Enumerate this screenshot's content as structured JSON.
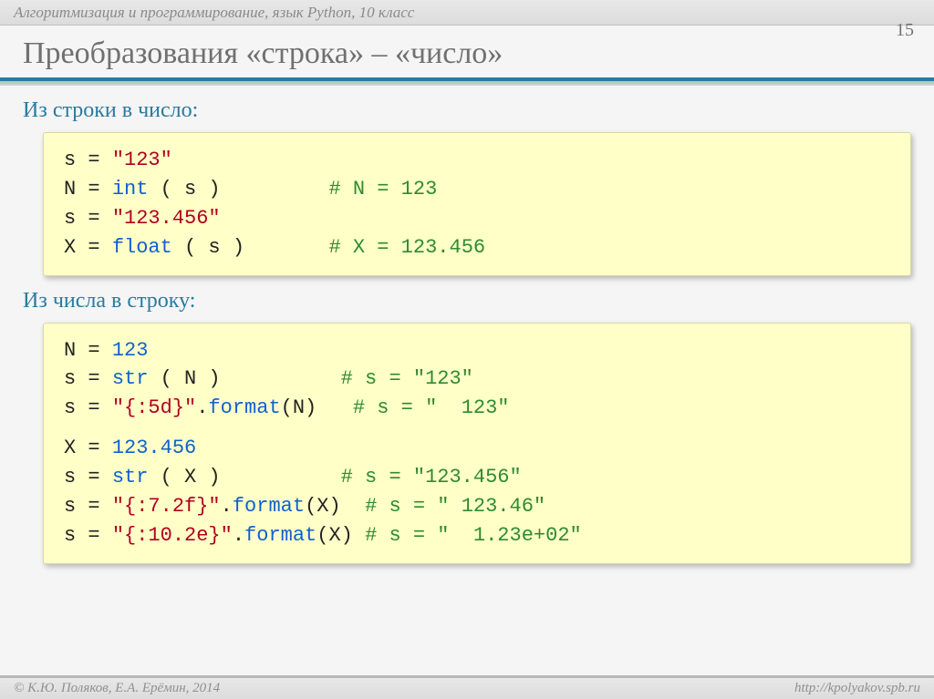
{
  "header": "Алгоритмизация и программирование, язык Python, 10 класс",
  "page_number": "15",
  "title": "Преобразования «строка» – «число»",
  "section1_label": "Из строки в число:",
  "section2_label": "Из числа в строку:",
  "code1": {
    "l1": {
      "a": "s = ",
      "b": "\"123\""
    },
    "l2": {
      "a": "N = ",
      "b": "int",
      "c": " ( s )         ",
      "d": "# N = 123"
    },
    "l3": {
      "a": "s = ",
      "b": "\"123.456\""
    },
    "l4": {
      "a": "X = ",
      "b": "float",
      "c": " ( s )       ",
      "d": "# X = 123.456"
    }
  },
  "code2": {
    "l1": {
      "a": "N = ",
      "b": "123"
    },
    "l2": {
      "a": "s = ",
      "b": "str",
      "c": " ( N )          ",
      "d": "# s = \"123\""
    },
    "l3": {
      "a": "s = ",
      "b": "\"{:5d}\"",
      "c": ".",
      "d": "format",
      "e": "(N)   ",
      "f": "# s = \"  123\""
    },
    "l4": {
      "a": "X = ",
      "b": "123.456"
    },
    "l5": {
      "a": "s = ",
      "b": "str",
      "c": " ( X )          ",
      "d": "# s = \"123.456\""
    },
    "l6": {
      "a": "s = ",
      "b": "\"{:7.2f}\"",
      "c": ".",
      "d": "format",
      "e": "(X)  ",
      "f": "# s = \" 123.46\""
    },
    "l7": {
      "a": "s = ",
      "b": "\"{:10.2e}\"",
      "c": ".",
      "d": "format",
      "e": "(X) ",
      "f": "# s = \"  1.23e+02\""
    }
  },
  "footer_left": "© К.Ю. Поляков, Е.А. Ерёмин, 2014",
  "footer_right": "http://kpolyakov.spb.ru"
}
